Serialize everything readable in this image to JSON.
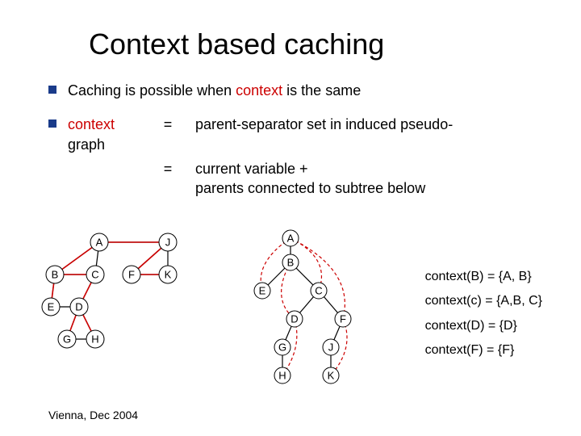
{
  "title": "Context based caching",
  "bullet1": {
    "pre": "Caching is possible when ",
    "ctx": "context",
    "post": " is the same"
  },
  "bullet2": {
    "lhs_l1": "context",
    "lhs_l2": "graph",
    "eq1": "=",
    "rhs1": "parent-separator set in induced pseudo-",
    "eq2": "=",
    "rhs2_l1": "current variable +",
    "rhs2_l2": "parents connected to subtree below"
  },
  "nodes": {
    "A": "A",
    "B": "B",
    "C": "C",
    "D": "D",
    "E": "E",
    "F": "F",
    "G": "G",
    "H": "H",
    "J": "J",
    "K": "K"
  },
  "context_lines": {
    "l1": "context(B) = {A, B}",
    "l2": "context(c) = {A,B, C}",
    "l3": "context(D) = {D}",
    "l4": "context(F) = {F}"
  },
  "footer": "Vienna, Dec 2004"
}
